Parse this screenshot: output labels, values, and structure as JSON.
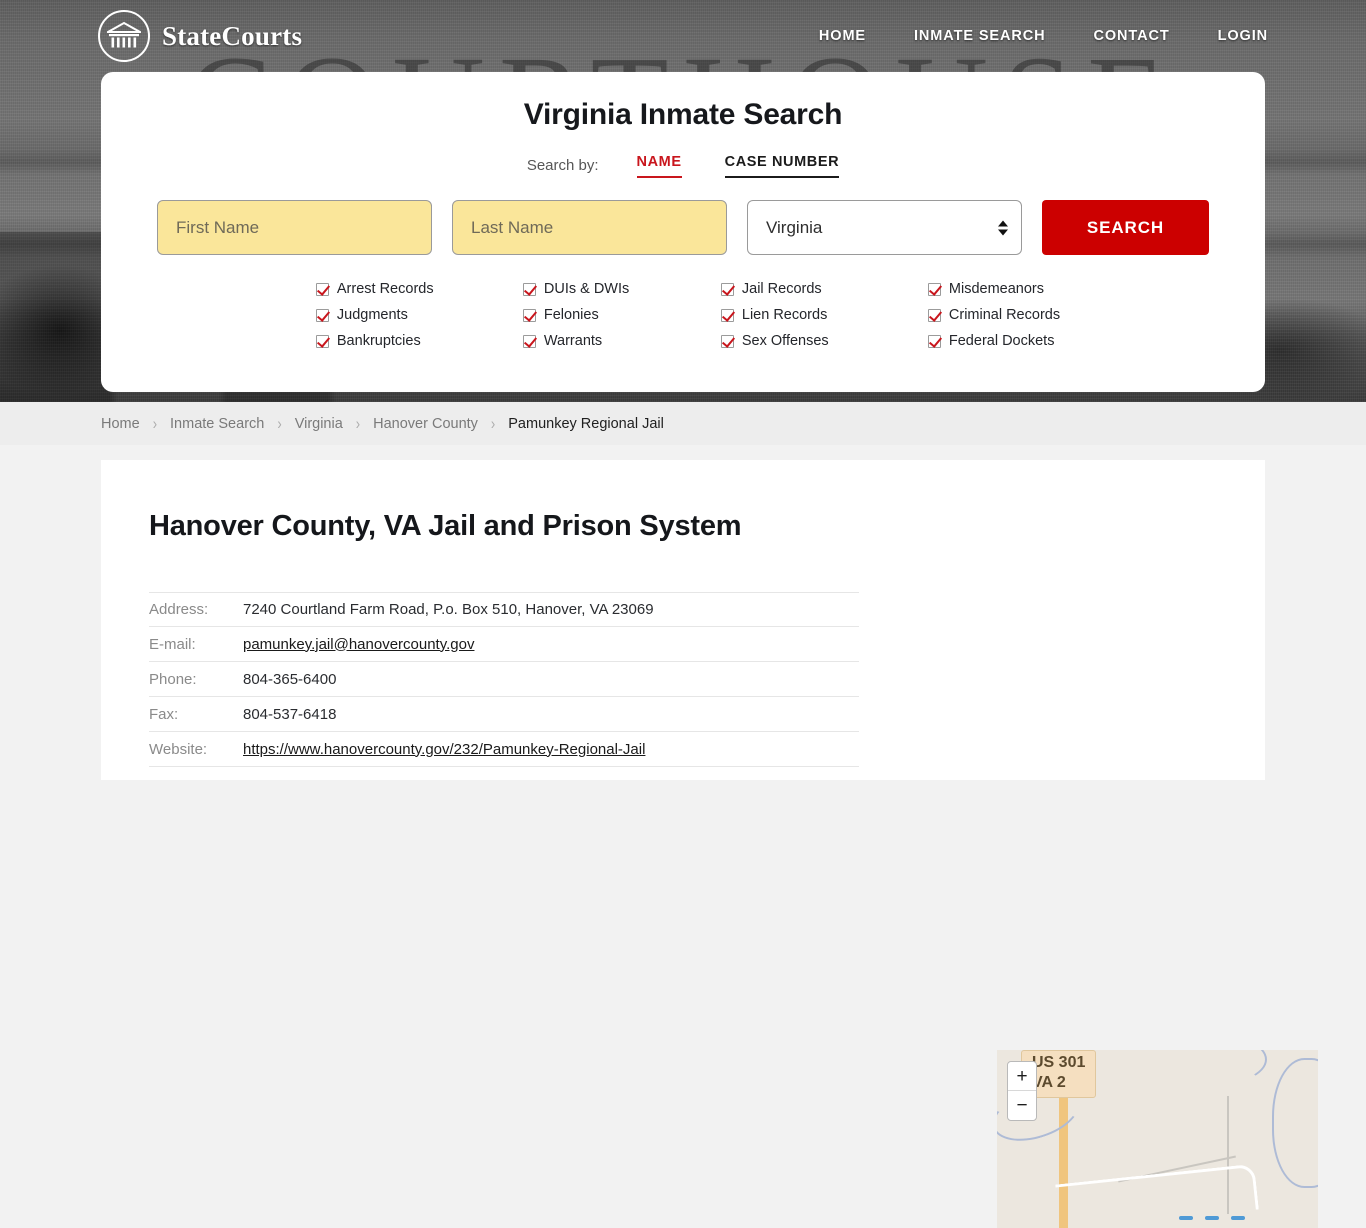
{
  "header": {
    "brand_name": "StateCourts",
    "brand_icon": "courthouse-circle-icon",
    "nav": [
      {
        "label": "HOME"
      },
      {
        "label": "INMATE SEARCH"
      },
      {
        "label": "CONTACT"
      },
      {
        "label": "LOGIN"
      }
    ]
  },
  "hero": {
    "background_word": "COURTHOUSE"
  },
  "search": {
    "title": "Virginia Inmate Search",
    "search_by_label": "Search by:",
    "tabs": [
      {
        "label": "NAME",
        "active": true
      },
      {
        "label": "CASE NUMBER",
        "active": false
      }
    ],
    "first_name_placeholder": "First Name",
    "first_name_value": "",
    "last_name_placeholder": "Last Name",
    "last_name_value": "",
    "state_selected": "Virginia",
    "submit_label": "SEARCH",
    "record_types": [
      "Arrest Records",
      "DUIs & DWIs",
      "Jail Records",
      "Misdemeanors",
      "Judgments",
      "Felonies",
      "Lien Records",
      "Criminal Records",
      "Bankruptcies",
      "Warrants",
      "Sex Offenses",
      "Federal Dockets"
    ],
    "accent_color": "#c9161d",
    "button_color": "#cc0000",
    "field_color": "#fae69a"
  },
  "breadcrumb": [
    {
      "label": "Home",
      "current": false
    },
    {
      "label": "Inmate Search",
      "current": false
    },
    {
      "label": "Virginia",
      "current": false
    },
    {
      "label": "Hanover County",
      "current": false
    },
    {
      "label": "Pamunkey Regional Jail",
      "current": true
    }
  ],
  "breadcrumb_separator": "›",
  "main": {
    "page_title": "Hanover County, VA Jail and Prison System",
    "details": [
      {
        "label": "Address:",
        "value": "7240 Courtland Farm Road, P.o. Box 510, Hanover, VA 23069",
        "link": false
      },
      {
        "label": "E-mail:",
        "value": "pamunkey.jail@hanovercounty.gov",
        "link": true
      },
      {
        "label": "Phone:",
        "value": "804-365-6400",
        "link": false
      },
      {
        "label": "Fax:",
        "value": "804-537-6418",
        "link": false
      },
      {
        "label": "Website:",
        "value": "https://www.hanovercounty.gov/232/Pamunkey-Regional-Jail",
        "link": true
      }
    ]
  },
  "map": {
    "highway_label_line1": "US 301",
    "highway_label_line2": "VA 2",
    "zoom_in_label": "+",
    "zoom_out_label": "−"
  }
}
